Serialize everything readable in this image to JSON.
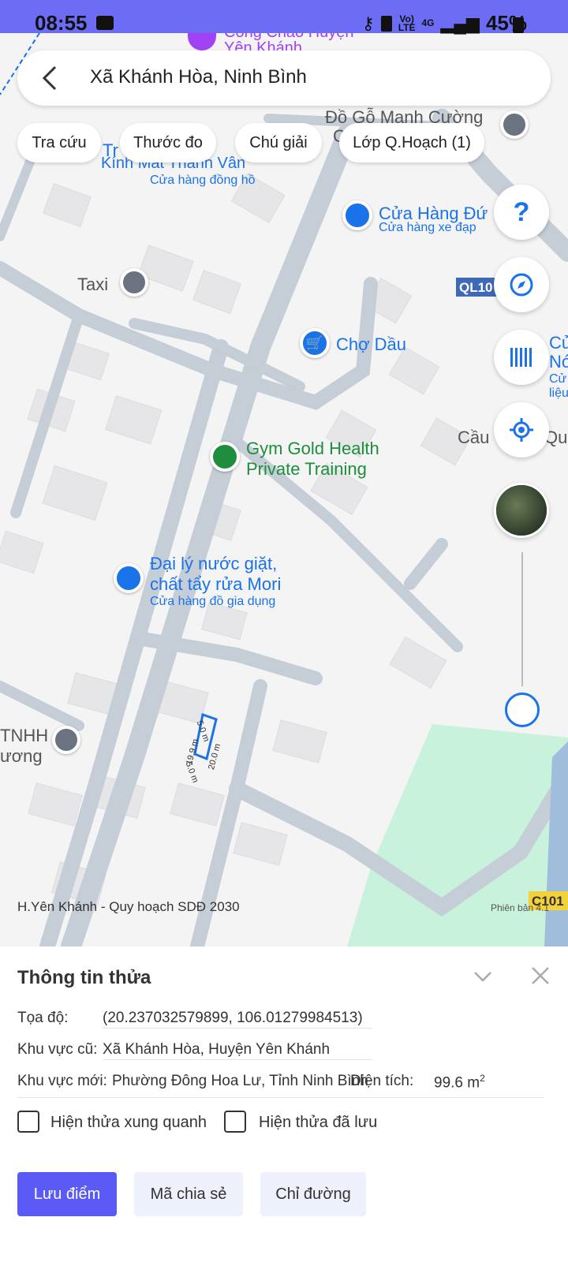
{
  "status_bar": {
    "time": "08:55",
    "network_label_1": "Vo)",
    "network_label_2": "LTE",
    "network_type": "4G",
    "battery": "45%"
  },
  "search": {
    "value": "Xã Khánh Hòa, Ninh Bình"
  },
  "chips": {
    "lookup": "Tra cứu",
    "ruler": "Thước đo",
    "legend": "Chú giải",
    "layer": "Lớp Q.Hoạch (1)"
  },
  "map": {
    "poi_taxi": "Taxi",
    "poi_market": "Chợ Dầu",
    "poi_gym_1": "Gym Gold Health",
    "poi_gym_2": "Private Training",
    "poi_detergent_1": "Đại lý nước giặt,",
    "poi_detergent_2": "chất tẩy rửa Mori",
    "poi_detergent_sub": "Cửa hàng đồ gia dụng",
    "poi_shop": "Cửa Hàng Đứ",
    "poi_shop_sub": "Cửa hàng xe đạp",
    "poi_watch_sub": "Cửa hàng đồng hồ",
    "poi_watch": "Kính Mắt Thanh Vân",
    "poi_watch_prefix": "Tr",
    "poi_furniture": "Đồ Gỗ Mạnh Cường",
    "poi_furniture_2": "C",
    "poi_gate_1": "Cổng Chào Huyện",
    "poi_gate_2": "Yên Khánh",
    "poi_bridge": "Cầu",
    "poi_bridge_2": "Quố",
    "poi_right_1": "Cử",
    "poi_right_2": "Nó",
    "poi_right_3": "Cử",
    "poi_right_4": "liệu",
    "poi_company_1": "TNHH",
    "poi_company_2": "ương",
    "road_ql": "QL10",
    "road_ql_2": "C101",
    "plan_label": "H.Yên Khánh - Quy hoạch SDĐ 2030",
    "version": "Phiên bản 4.1",
    "dim_a": "5.0 m",
    "dim_b": "19.9 m",
    "dim_c": "20.0 m",
    "dim_d": "5.0 m"
  },
  "panel": {
    "title": "Thông tin thửa",
    "coord_label": "Tọa độ:",
    "coord_value": "(20.237032579899, 106.01279984513)",
    "old_area_label": "Khu vực cũ:",
    "old_area_value": "Xã Khánh Hòa, Huyện Yên Khánh",
    "new_area_label": "Khu vực mới:",
    "new_area_value": "Phường Đông Hoa Lư, Tỉnh Ninh Bình",
    "area_label": "Diện tích:",
    "area_value": "99.6 m",
    "area_unit_sup": "2",
    "show_neighbors": "Hiện thửa xung quanh",
    "show_saved": "Hiện thửa đã lưu"
  },
  "buttons": {
    "save": "Lưu điểm",
    "share": "Mã chia sẻ",
    "directions": "Chỉ đường"
  },
  "colors": {
    "status_bar": "#6c6cf5",
    "primary": "#5a5af5",
    "map_blue": "#1a73e8",
    "green": "#1e8e3e",
    "road": "#c5cdd7"
  }
}
